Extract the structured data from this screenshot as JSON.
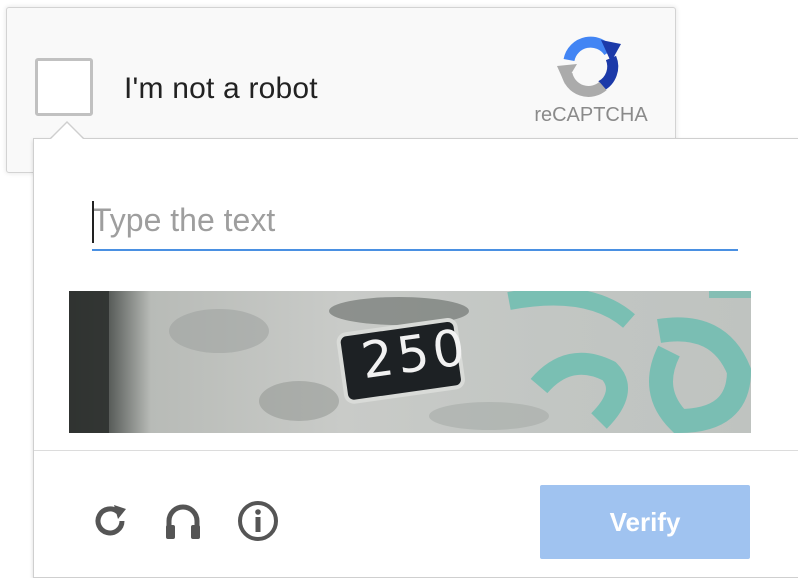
{
  "anchor": {
    "label": "I'm not a robot",
    "brand": "reCAPTCHA",
    "logo_icon": "recaptcha-logo-icon"
  },
  "challenge": {
    "input_placeholder": "Type the text",
    "input_value": "",
    "image_text": "250",
    "icons": {
      "reload": "reload-icon",
      "audio": "headphones-icon",
      "help": "info-icon"
    },
    "verify_label": "Verify"
  },
  "colors": {
    "accent": "#4a90e2",
    "verify_bg_disabled": "#a0c3f0",
    "checkbox_border": "#c1c1c1",
    "logo_blue": "#1c3aa9",
    "logo_light_blue": "#4285f4",
    "logo_gray": "#ababab"
  }
}
